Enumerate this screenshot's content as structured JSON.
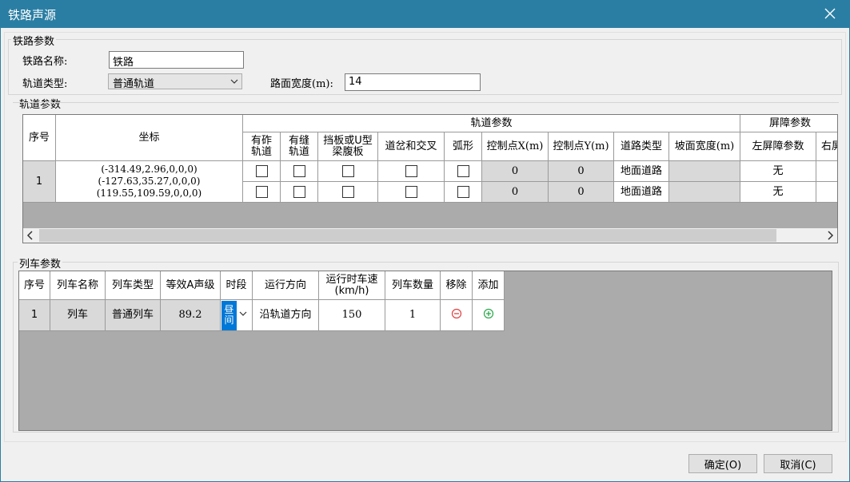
{
  "window": {
    "title": "铁路声源"
  },
  "railway_group": {
    "label": "铁路参数",
    "name_label": "铁路名称:",
    "name_value": "铁路",
    "track_type_label": "轨道类型:",
    "track_type_value": "普通轨道",
    "road_width_label": "路面宽度(m):",
    "road_width_value": "14"
  },
  "track_group": {
    "label": "轨道参数",
    "headers": {
      "index": "序号",
      "coords": "坐标",
      "track_params": "轨道参数",
      "ballast": "有砟轨道",
      "seamed": "有缝轨道",
      "baffle": "挡板或U型梁腹板",
      "switch": "道岔和交叉",
      "arc": "弧形",
      "ctrl_x": "控制点X(m)",
      "ctrl_y": "控制点Y(m)",
      "road_type": "道路类型",
      "slope_width": "坡面宽度(m)",
      "barrier_params": "屏障参数",
      "left_barrier": "左屏障参数",
      "right_barrier": "右屏"
    },
    "row_index": "1",
    "coords": [
      "(-314.49,2.96,0,0,0)",
      "(-127.63,35.27,0,0,0)",
      "(119.55,109.59,0,0,0)"
    ],
    "segments": [
      {
        "ctrl_x": "0",
        "ctrl_y": "0",
        "road_type": "地面道路",
        "left_barrier": "无"
      },
      {
        "ctrl_x": "0",
        "ctrl_y": "0",
        "road_type": "地面道路",
        "left_barrier": "无"
      }
    ]
  },
  "train_group": {
    "label": "列车参数",
    "headers": {
      "index": "序号",
      "name": "列车名称",
      "type": "列车类型",
      "level": "等效A声级",
      "period": "时段",
      "direction": "运行方向",
      "speed": "运行时车速(km/h)",
      "count": "列车数量",
      "remove": "移除",
      "add": "添加"
    },
    "rows": [
      {
        "index": "1",
        "name": "列车",
        "type": "普通列车",
        "level": "89.2",
        "period": "昼间",
        "direction": "沿轨道方向",
        "speed": "150",
        "count": "1"
      }
    ]
  },
  "buttons": {
    "ok": "确定(O)",
    "cancel": "取消(C)"
  },
  "colors": {
    "titlebar": "#2b7ea3",
    "remove": "#e04040",
    "add": "#2aa84a",
    "selection": "#0078d7"
  }
}
